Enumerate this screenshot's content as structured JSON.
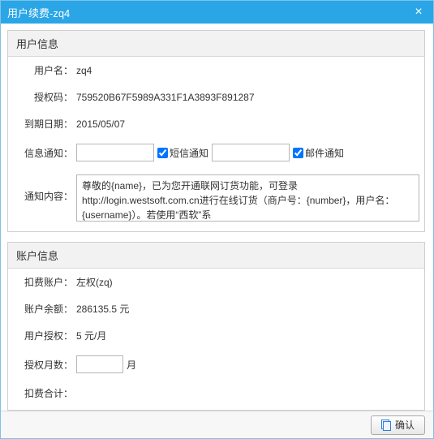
{
  "dialog": {
    "title": "用户续费-zq4",
    "close": "×"
  },
  "user_info": {
    "title": "用户信息",
    "username_label": "用户名：",
    "username_value": "zq4",
    "authcode_label": "授权码：",
    "authcode_value": "759520B67F5989A331F1A3893F891287",
    "expiry_label": "到期日期：",
    "expiry_value": "2015/05/07",
    "notify_label": "信息通知：",
    "sms_input": "",
    "sms_checkbox_label": "短信通知",
    "email_input": "",
    "email_checkbox_label": "邮件通知",
    "content_label": "通知内容：",
    "content_value": "尊敬的{name}，已为您开通联网订货功能，可登录http://login.westsoft.com.cn进行在线订货（商户号：{number}，用户名：{username}）。若使用“西软”系"
  },
  "account_info": {
    "title": "账户信息",
    "deduct_account_label": "扣费账户：",
    "deduct_account_value": "左权(zq)",
    "balance_label": "账户余额：",
    "balance_value": "286135.5 元",
    "auth_price_label": "用户授权：",
    "auth_price_value": "5 元/月",
    "months_label": "授权月数：",
    "months_input": "",
    "months_unit": "月",
    "total_label": "扣费合计："
  },
  "footer": {
    "confirm_label": "确认"
  }
}
